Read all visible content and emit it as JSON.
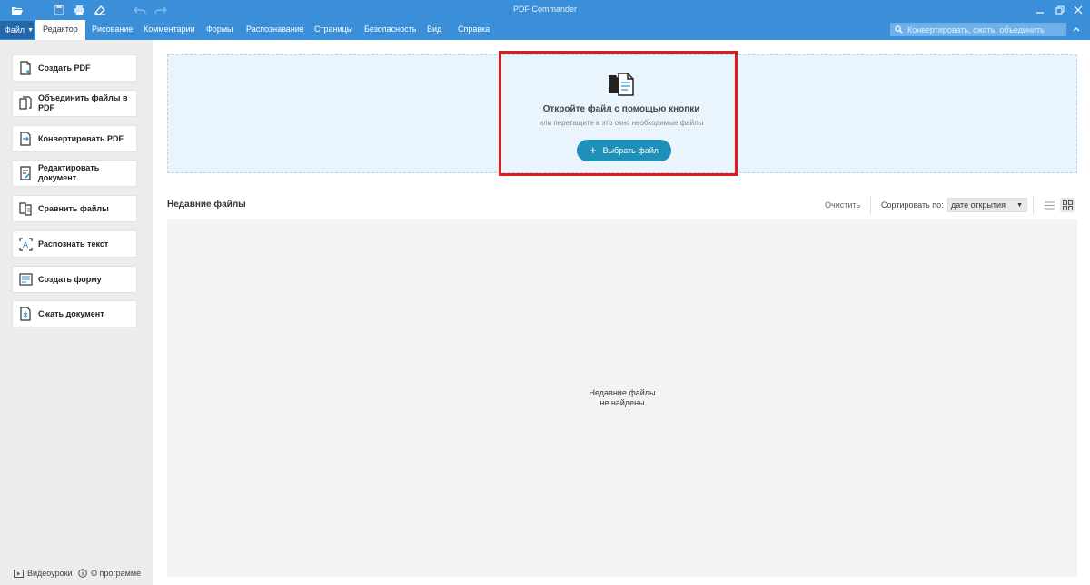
{
  "titlebar": {
    "title": "PDF Commander",
    "icons": [
      "open-folder-icon",
      "save-icon",
      "print-icon",
      "scan-icon",
      "undo-icon",
      "redo-icon"
    ],
    "window_controls": [
      "minimize-icon",
      "restore-icon",
      "close-icon"
    ]
  },
  "menubar": {
    "file_label": "Файл",
    "items": [
      {
        "label": "Редактор",
        "active": true
      },
      {
        "label": "Рисование"
      },
      {
        "label": "Комментарии"
      },
      {
        "label": "Формы"
      },
      {
        "label": "Распознавание"
      },
      {
        "label": "Страницы"
      },
      {
        "label": "Безопасность"
      },
      {
        "label": "Вид"
      },
      {
        "label": "Справка"
      }
    ],
    "search_placeholder": "Конвертировать, сжать, объединить"
  },
  "sidebar": {
    "items": [
      {
        "label": "Создать PDF",
        "icon": "create-pdf-icon"
      },
      {
        "label": "Объединить файлы в PDF",
        "icon": "merge-files-icon"
      },
      {
        "label": "Конвертировать PDF",
        "icon": "convert-pdf-icon"
      },
      {
        "label": "Редактировать документ",
        "icon": "edit-document-icon"
      },
      {
        "label": "Сравнить файлы",
        "icon": "compare-files-icon"
      },
      {
        "label": "Распознать текст",
        "icon": "ocr-icon"
      },
      {
        "label": "Создать форму",
        "icon": "create-form-icon"
      },
      {
        "label": "Сжать документ",
        "icon": "compress-document-icon"
      }
    ],
    "footer": {
      "videos_label": "Видеоуроки",
      "about_label": "О программе"
    }
  },
  "dropzone": {
    "title": "Откройте файл с помощью кнопки",
    "subtitle": "или перетащите в это окно необходимые файлы",
    "button_label": "Выбрать файл"
  },
  "recent": {
    "title": "Недавние файлы",
    "clear_label": "Очистить",
    "sort_label": "Сортировать по:",
    "sort_value": "дате открытия",
    "empty_line1": "Недавние файлы",
    "empty_line2": "не найдены",
    "view_modes": [
      "list-view-icon",
      "grid-view-icon"
    ],
    "active_view": "grid"
  },
  "colors": {
    "titlebar": "#3b8fd9",
    "file_menu": "#2568a8",
    "accent_button": "#1e8fb8",
    "highlight_box": "#e11a1a",
    "dropzone_bg": "#eaf4fc"
  }
}
